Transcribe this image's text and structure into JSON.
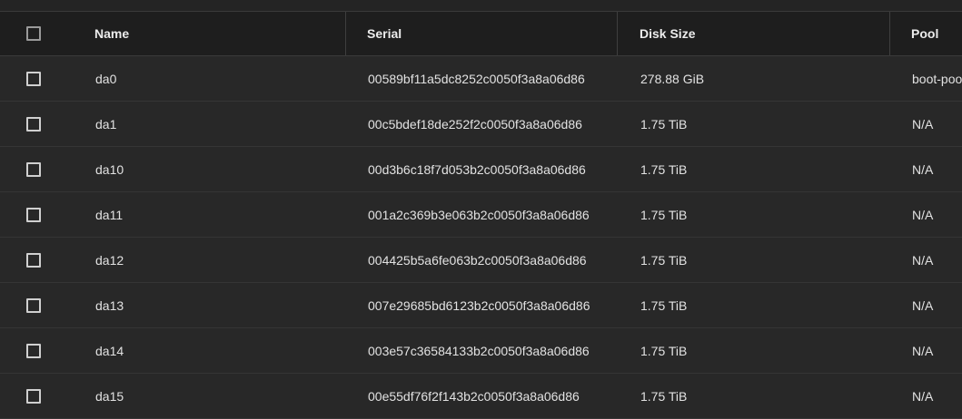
{
  "table": {
    "columns": {
      "name": "Name",
      "serial": "Serial",
      "disk_size": "Disk Size",
      "pool": "Pool"
    },
    "rows": [
      {
        "name": "da0",
        "serial": "00589bf11a5dc8252c0050f3a8a06d86",
        "disk_size": "278.88 GiB",
        "pool": "boot-poo"
      },
      {
        "name": "da1",
        "serial": "00c5bdef18de252f2c0050f3a8a06d86",
        "disk_size": "1.75 TiB",
        "pool": "N/A"
      },
      {
        "name": "da10",
        "serial": "00d3b6c18f7d053b2c0050f3a8a06d86",
        "disk_size": "1.75 TiB",
        "pool": "N/A"
      },
      {
        "name": "da11",
        "serial": "001a2c369b3e063b2c0050f3a8a06d86",
        "disk_size": "1.75 TiB",
        "pool": "N/A"
      },
      {
        "name": "da12",
        "serial": "004425b5a6fe063b2c0050f3a8a06d86",
        "disk_size": "1.75 TiB",
        "pool": "N/A"
      },
      {
        "name": "da13",
        "serial": "007e29685bd6123b2c0050f3a8a06d86",
        "disk_size": "1.75 TiB",
        "pool": "N/A"
      },
      {
        "name": "da14",
        "serial": "003e57c36584133b2c0050f3a8a06d86",
        "disk_size": "1.75 TiB",
        "pool": "N/A"
      },
      {
        "name": "da15",
        "serial": "00e55df76f2f143b2c0050f3a8a06d86",
        "disk_size": "1.75 TiB",
        "pool": "N/A"
      }
    ]
  }
}
